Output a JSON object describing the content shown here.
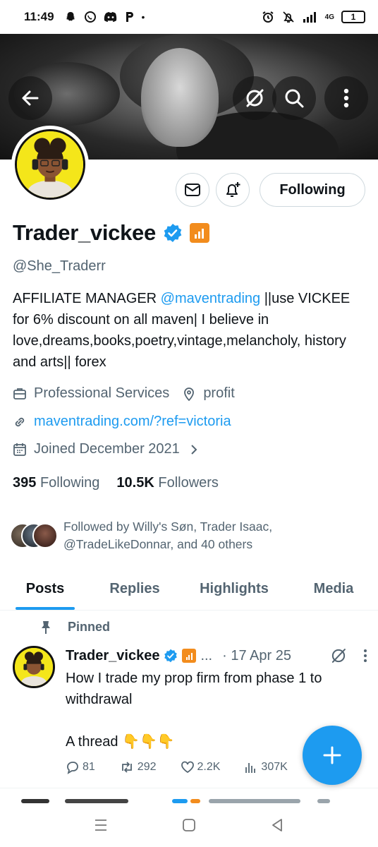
{
  "status_bar": {
    "time": "11:49",
    "network": "4G",
    "battery": "1"
  },
  "profile": {
    "display_name": "Trader_vickee",
    "handle": "@She_Traderr",
    "bio_prefix": "AFFILIATE MANAGER ",
    "bio_mention": "@maventrading",
    "bio_rest": " ||use VICKEE for 6% discount on all maven| I believe in love,dreams,books,poetry,vintage,melancholy, history and arts|| forex",
    "category": "Professional Services",
    "location": "profit",
    "website": "maventrading.com/?ref=victoria",
    "joined": "Joined December 2021",
    "following_count": "395",
    "following_label": "Following",
    "followers_count": "10.5K",
    "followers_label": "Followers",
    "followed_by": "Followed by Willy's Søn, Trader Isaac, @TradeLikeDonnar, and 40 others"
  },
  "actions": {
    "following_button": "Following"
  },
  "tabs": [
    {
      "label": "Posts",
      "active": true
    },
    {
      "label": "Replies",
      "active": false
    },
    {
      "label": "Highlights",
      "active": false
    },
    {
      "label": "Media",
      "active": false
    }
  ],
  "pinned_post": {
    "pinned_label": "Pinned",
    "author": "Trader_vickee",
    "ellipsis": "...",
    "date": "· 17 Apr 25",
    "line1": "How I trade my prop firm from phase 1 to withdrawal",
    "line2": "A thread 👇👇👇",
    "replies": "81",
    "reposts": "292",
    "likes": "2.2K",
    "views": "307K"
  },
  "colors": {
    "accent": "#1d9bf0",
    "badge_orange": "#f28c1d",
    "avatar_yellow": "#f4e61a",
    "secondary_text": "#536471"
  }
}
